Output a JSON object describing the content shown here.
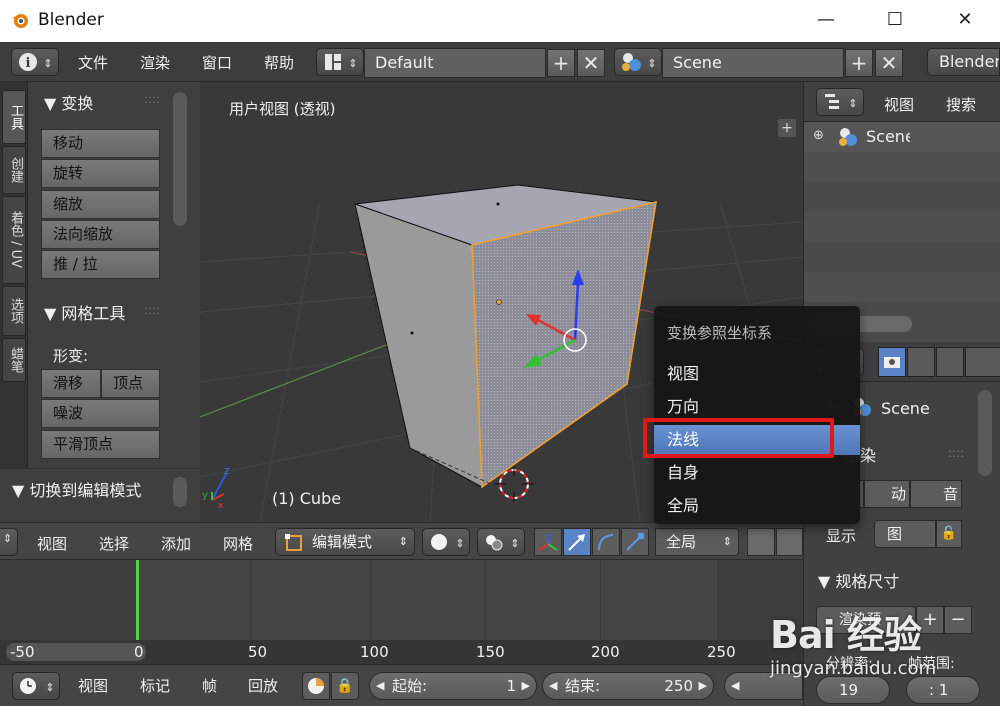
{
  "window": {
    "title": "Blender",
    "minimize": "—",
    "maximize": "☐",
    "close": "✕"
  },
  "topbar": {
    "menus": [
      "文件",
      "渲染",
      "窗口",
      "帮助"
    ],
    "layout": "Default",
    "scene": "Scene",
    "engine": "Blender"
  },
  "sidetabs": [
    "工具",
    "创建",
    "着色 / UV",
    "选项",
    "蜡笔"
  ],
  "transform_panel": {
    "title": "▼ 变换",
    "buttons": [
      "移动",
      "旋转",
      "缩放",
      "法向缩放",
      "推 / 拉"
    ]
  },
  "mesh_tools_panel": {
    "title": "▼ 网格工具",
    "deform_label": "形变:",
    "slide": "滑移",
    "vertex": "顶点",
    "noise": "噪波",
    "smooth_vertex": "平滑顶点"
  },
  "switch_panel": {
    "title": "▼ 切换到编辑模式"
  },
  "viewport": {
    "view_label": "用户视图 (透视)",
    "object_label": "(1) Cube"
  },
  "orientation_popup": {
    "title": "变换参照坐标系",
    "items": [
      "视图",
      "万向",
      "法线",
      "自身",
      "全局"
    ],
    "highlighted": "法线"
  },
  "viewport_header": {
    "menus": [
      "视图",
      "选择",
      "添加",
      "网格"
    ],
    "mode": "编辑模式",
    "orientation": "全局"
  },
  "timeline": {
    "ticks": [
      "-50",
      "0",
      "50",
      "100",
      "150",
      "200",
      "250"
    ],
    "menus": [
      "视图",
      "标记",
      "帧",
      "回放"
    ],
    "start_label": "起始:",
    "start_value": "1",
    "end_label": "结束:",
    "end_value": "250"
  },
  "outliner": {
    "menus": [
      "视图",
      "搜索"
    ],
    "scene_item": "Scene"
  },
  "properties": {
    "scene": "Scene",
    "render_label": "渲染",
    "animation_label": "动",
    "audio_label": "音",
    "display_label": "显示",
    "display_value": "图",
    "dimensions_title": "▼ 规格尺寸",
    "render_preset": "渲染预",
    "resolution_label": "分辨率:",
    "frame_range_label": "帧范围:",
    "res_value": "19",
    "frame_value": ": 1"
  },
  "watermark": {
    "main": "Bai 经验",
    "url": "jingyan.baidu.com"
  },
  "colors": {
    "accent_blue": "#5a82c6",
    "highlight_red": "#e0181b",
    "selected_orange": "#f0a030"
  }
}
